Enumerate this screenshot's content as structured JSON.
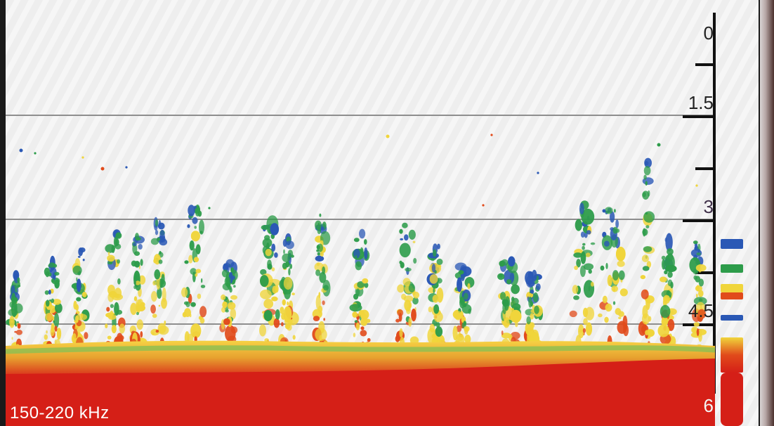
{
  "sonar": {
    "depth_labels": [
      {
        "value": "0",
        "depth": 0
      },
      {
        "value": "1.5",
        "depth": 1.5
      },
      {
        "value": "3",
        "depth": 3
      },
      {
        "value": "4.5",
        "depth": 4.5
      },
      {
        "value": "6",
        "depth": 6
      }
    ],
    "frequency": "150-220 kHz",
    "colors": {
      "background": "#ececec",
      "bottom": "#d51f17",
      "strong_return": "#e14b1b",
      "medium_return": "#f0d53b",
      "weak_return": "#2d9c4a",
      "faint_return": "#2a58b5",
      "depth_line": "#8e8e8e",
      "frequency_text": "#ffffff"
    },
    "legend_colors": [
      "#2a58b5",
      "#2d9c4a",
      "#f0d53b",
      "#e14b1b",
      "#d51f17"
    ]
  }
}
